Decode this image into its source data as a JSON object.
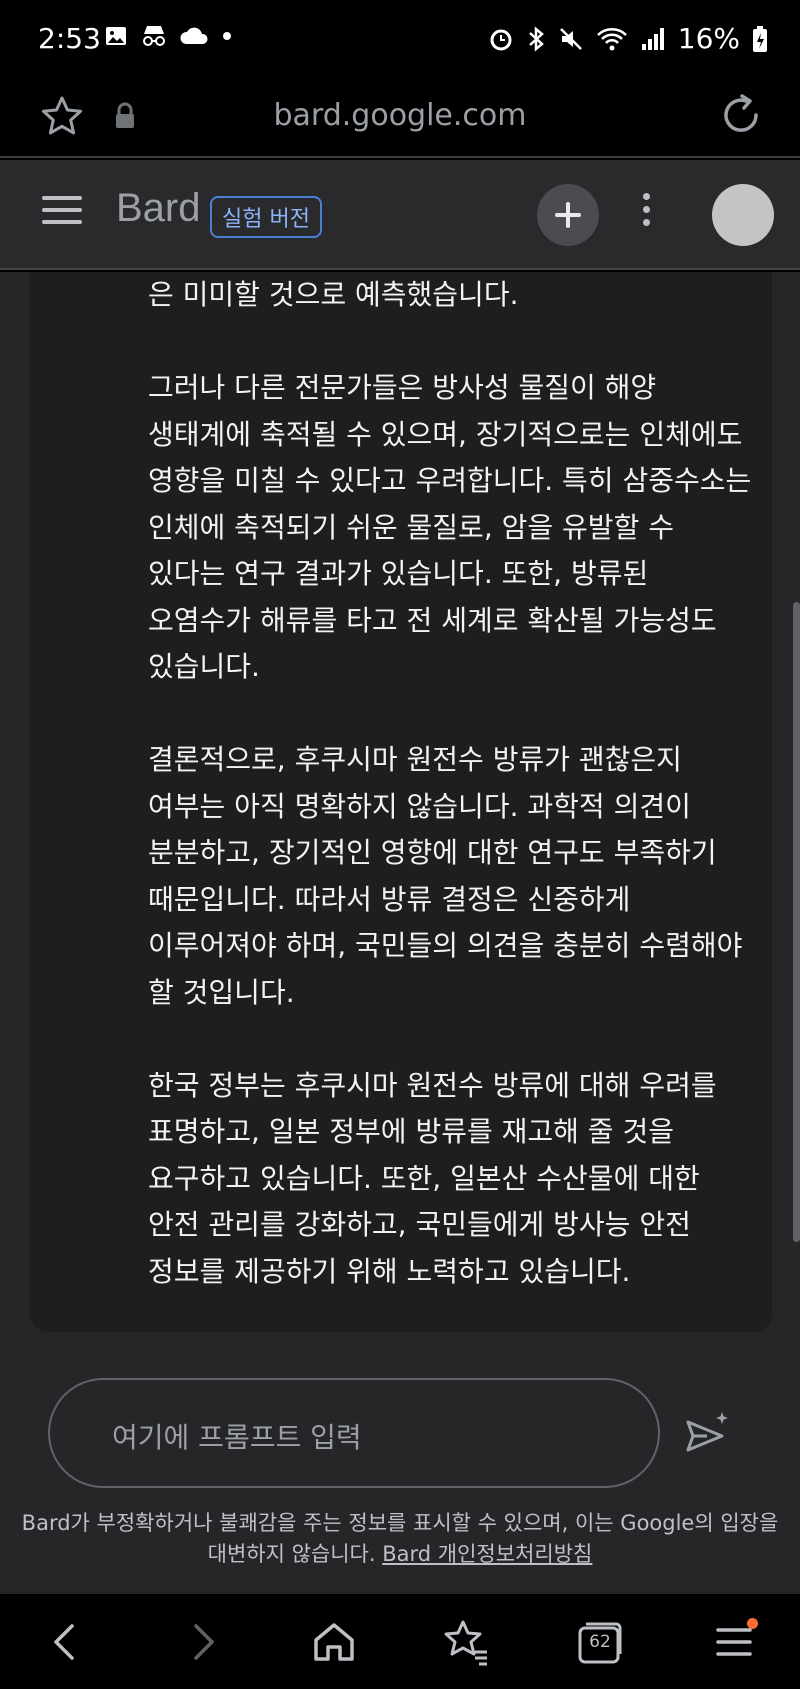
{
  "status_bar": {
    "time": "2:53",
    "battery": "16%",
    "left_icons": [
      "gallery-icon",
      "incognito-icon",
      "cloud-icon",
      "dot-icon"
    ],
    "right_icons": [
      "alarm-icon",
      "bluetooth-icon",
      "mute-icon",
      "wifi-icon",
      "signal-icon",
      "battery-charging-icon"
    ]
  },
  "browser": {
    "url": "bard.google.com"
  },
  "header": {
    "brand": "Bard",
    "badge": "실험 버전"
  },
  "response": {
    "paragraphs": [
      "은 미미할 것으로 예측했습니다.",
      "그러나 다른 전문가들은 방사성 물질이 해양 생태계에 축적될 수 있으며, 장기적으로는 인체에도 영향을 미칠 수 있다고 우려합니다. 특히 삼중수소는 인체에 축적되기 쉬운 물질로, 암을 유발할 수 있다는 연구 결과가 있습니다. 또한, 방류된 오염수가 해류를 타고 전 세계로 확산될 가능성도 있습니다.",
      "결론적으로, 후쿠시마 원전수 방류가 괜찮은지 여부는 아직 명확하지 않습니다. 과학적 의견이 분분하고, 장기적인 영향에 대한 연구도 부족하기 때문입니다. 따라서 방류 결정은 신중하게 이루어져야 하며, 국민들의 의견을 충분히 수렴해야 할 것입니다.",
      "한국 정부는 후쿠시마 원전수 방류에 대해 우려를 표명하고, 일본 정부에 방류를 재고해 줄 것을 요구하고 있습니다. 또한, 일본산 수산물에 대한 안전 관리를 강화하고, 국민들에게 방사능 안전 정보를 제공하기 위해 노력하고 있습니다."
    ]
  },
  "prompt": {
    "placeholder": "여기에 프롬프트 입력"
  },
  "disclaimer": {
    "text": "Bard가 부정확하거나 불쾌감을 주는 정보를 표시할 수 있으며, 이는 Google의 입장을 대변하지 않습니다.",
    "link": "Bard 개인정보처리방침"
  },
  "bottom_nav": {
    "tab_count": "62",
    "items": [
      "back-icon",
      "forward-icon",
      "home-icon",
      "bookmarks-icon",
      "tabs-icon",
      "menu-icon"
    ]
  },
  "colors": {
    "accent": "#8ab4f8",
    "background": "#262628",
    "card": "#1e1e20",
    "notification": "#ff6d2e"
  }
}
